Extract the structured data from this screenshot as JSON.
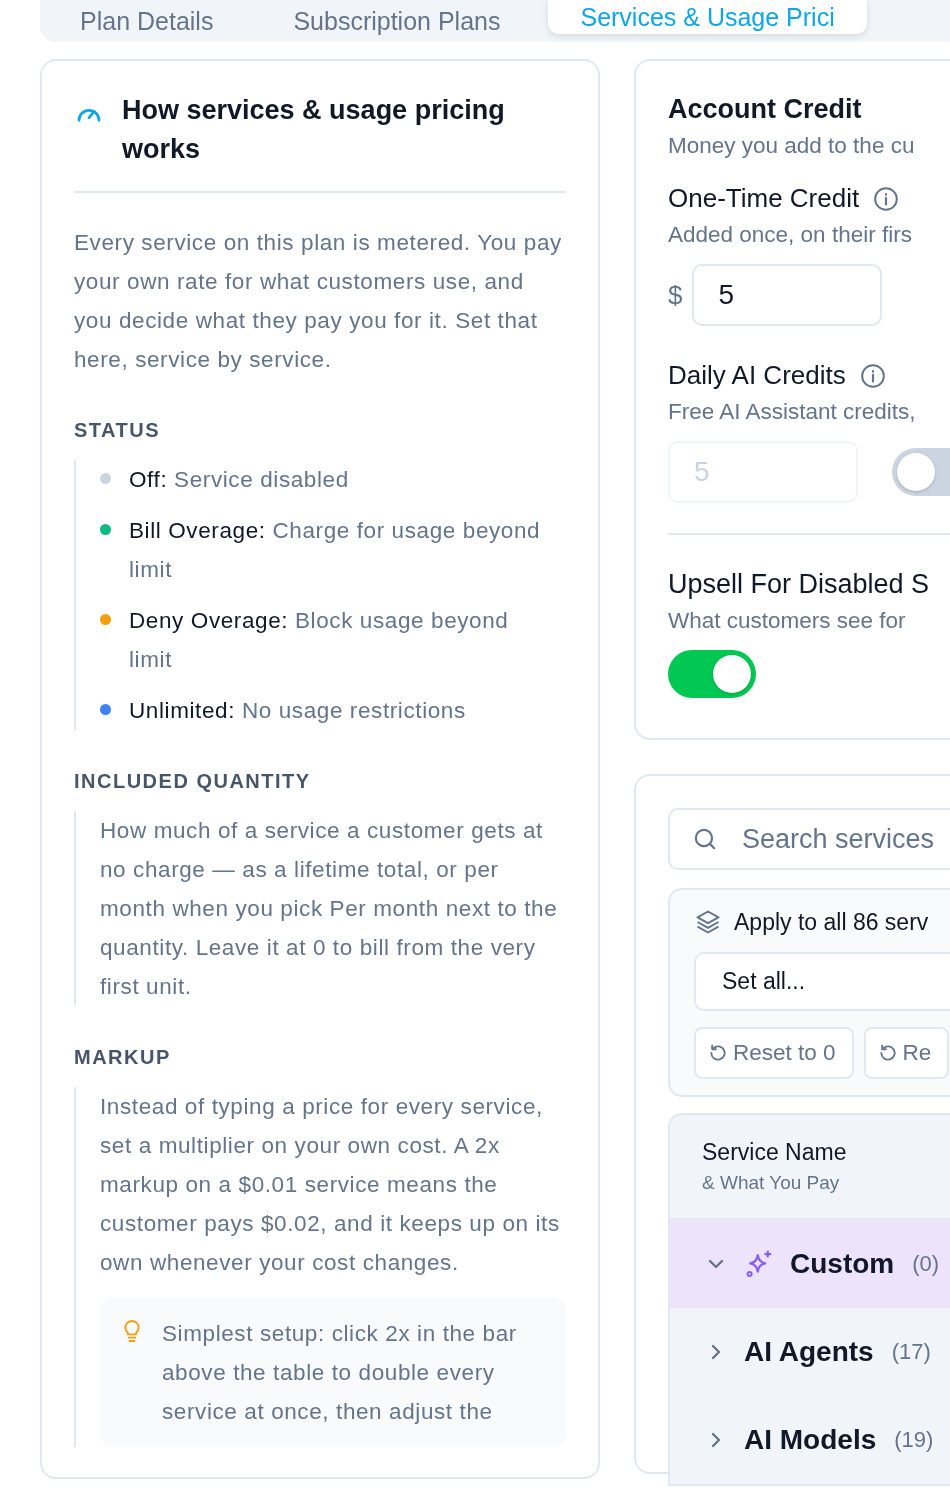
{
  "tabs": [
    {
      "label": "Plan Details",
      "selected": false
    },
    {
      "label": "Subscription Plans",
      "selected": false
    },
    {
      "label": "Services & Usage Prici",
      "selected": true
    }
  ],
  "guide": {
    "title": "How services & usage pricing works",
    "intro": "Every service on this plan is metered. You pay your own rate for what customers use, and you decide what they pay you for it. Set that here, service by service.",
    "status": {
      "heading": "STATUS",
      "items": [
        {
          "term": "Off:",
          "description": "Service disabled",
          "color": "#cbd5e1"
        },
        {
          "term": "Bill Overage:",
          "description": "Charge for usage beyond limit",
          "color": "#10b981"
        },
        {
          "term": "Deny Overage:",
          "description": "Block usage beyond limit",
          "color": "#f59e0b"
        },
        {
          "term": "Unlimited:",
          "description": "No usage restrictions",
          "color": "#3b82f6"
        }
      ]
    },
    "included": {
      "heading": "INCLUDED QUANTITY",
      "text": "How much of a service a customer gets at no charge — as a lifetime total, or per month when you pick Per month next to the quantity. Leave it at 0 to bill from the very first unit."
    },
    "markup": {
      "heading": "MARKUP",
      "text": "Instead of typing a price for every service, set a multiplier on your own cost. A 2x markup on a $0.01 service means the customer pays $0.02, and it keeps up on its own whenever your cost changes.",
      "tip": "Simplest setup: click 2x in the bar above the table to double every service at once, then adjust the"
    }
  },
  "credit": {
    "title": "Account Credit",
    "subtitle": "Money you add to the cu",
    "one_time": {
      "label": "One-Time Credit",
      "help": "Added once, on their firs",
      "currency": "$",
      "value": "5"
    },
    "daily": {
      "label": "Daily AI Credits",
      "help": "Free AI Assistant credits,",
      "value": "5",
      "disabled": true,
      "on": false
    },
    "upsell": {
      "title": "Upsell For Disabled S",
      "help": "What customers see for",
      "on": true
    }
  },
  "services": {
    "search": {
      "placeholder": "Search services"
    },
    "bulk": {
      "title": "Apply to all 86 serv",
      "select": "Set all...",
      "buttons": [
        "Reset to 0",
        "Re"
      ]
    },
    "table": {
      "column": {
        "title": "Service Name",
        "subtitle": "& What You Pay"
      },
      "groups": [
        {
          "kind": "custom",
          "name": "Custom",
          "count": "(0)",
          "expanded": true,
          "selected": true
        },
        {
          "kind": "plain",
          "name": "AI Agents",
          "count": "(17)",
          "expanded": false,
          "selected": false
        },
        {
          "kind": "plain",
          "name": "AI Models",
          "count": "(19)",
          "expanded": false,
          "selected": false
        }
      ]
    }
  }
}
